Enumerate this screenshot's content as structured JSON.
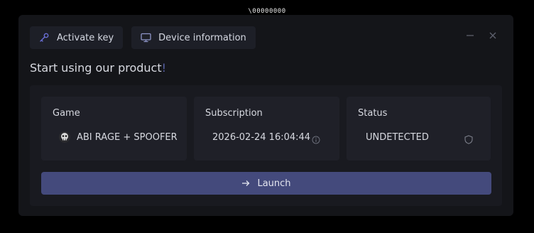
{
  "caption": "\\00000000",
  "tabs": [
    {
      "label": "Activate key",
      "icon": "key-icon"
    },
    {
      "label": "Device information",
      "icon": "monitor-icon"
    }
  ],
  "window_controls": {
    "minimize": "minimize-icon",
    "close": "close-icon"
  },
  "headline": {
    "text": "Start using our product",
    "accent": "!"
  },
  "cards": {
    "game": {
      "label": "Game",
      "value": "ABI RAGE + SPOOFER"
    },
    "subscription": {
      "label": "Subscription",
      "value": "2026-02-24 16:04:44",
      "info_icon": "info-icon"
    },
    "status": {
      "label": "Status",
      "value": "UNDETECTED",
      "icon": "shield-icon"
    }
  },
  "launch": {
    "label": "Launch",
    "icon": "arrow-right-icon"
  },
  "colors": {
    "accent": "#444a7c",
    "status_ok": "#3aa55a",
    "window_bg": "#141519"
  }
}
